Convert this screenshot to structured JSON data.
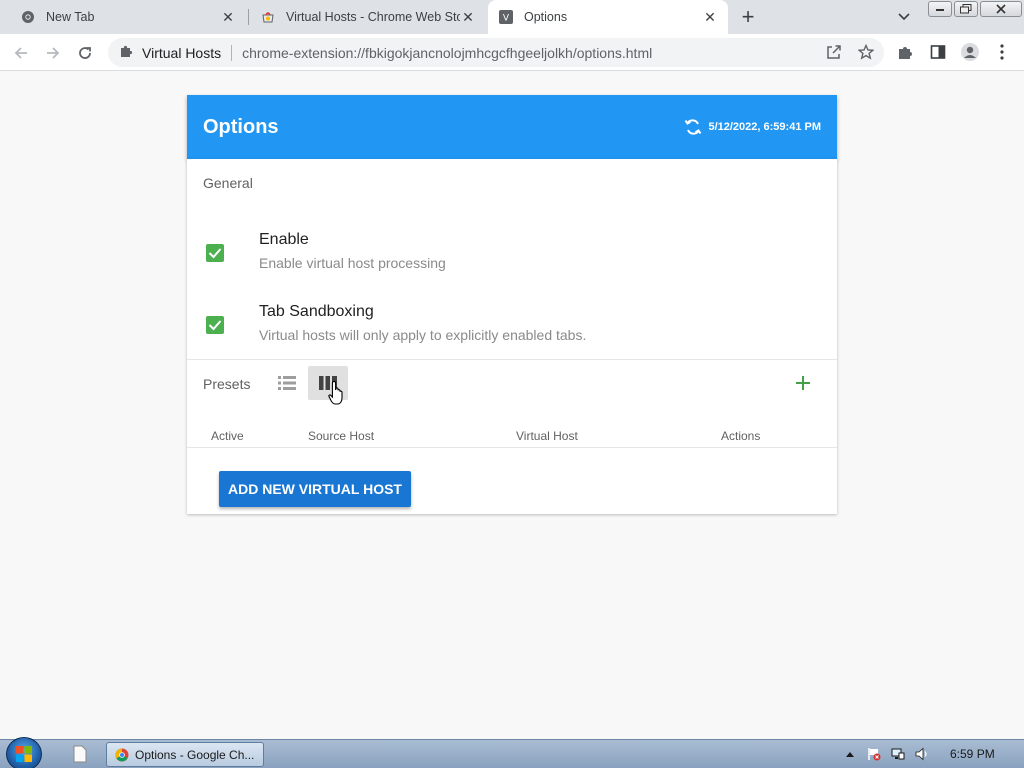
{
  "browser": {
    "tabs": [
      {
        "title": "New Tab",
        "icon": "chrome-icon"
      },
      {
        "title": "Virtual Hosts - Chrome Web Stor",
        "icon": "web-store-icon"
      },
      {
        "title": "Options",
        "icon": "extension-v-icon",
        "favicon_letter": "V"
      }
    ],
    "omnibox": {
      "site_name": "Virtual Hosts",
      "url": "chrome-extension://fbkigokjancnolojmhcgcfhgeeljolkh/options.html"
    }
  },
  "page": {
    "header": {
      "title": "Options",
      "sync_time": "5/12/2022, 6:59:41 PM"
    },
    "general": {
      "label": "General",
      "options": [
        {
          "title": "Enable",
          "subtitle": "Enable virtual host processing",
          "checked": true
        },
        {
          "title": "Tab Sandboxing",
          "subtitle": "Virtual hosts will only apply to explicitly enabled tabs.",
          "checked": true
        }
      ]
    },
    "presets": {
      "label": "Presets",
      "columns": [
        "Active",
        "Source Host",
        "Virtual Host",
        "Actions"
      ],
      "add_button": "ADD NEW VIRTUAL HOST"
    },
    "colors": {
      "header": "#2196f3",
      "checkbox": "#4caf50",
      "primary_button": "#1976d2",
      "add_icon": "#43a047"
    }
  },
  "taskbar": {
    "window_title": "Options - Google Ch...",
    "clock": "6:59 PM"
  }
}
